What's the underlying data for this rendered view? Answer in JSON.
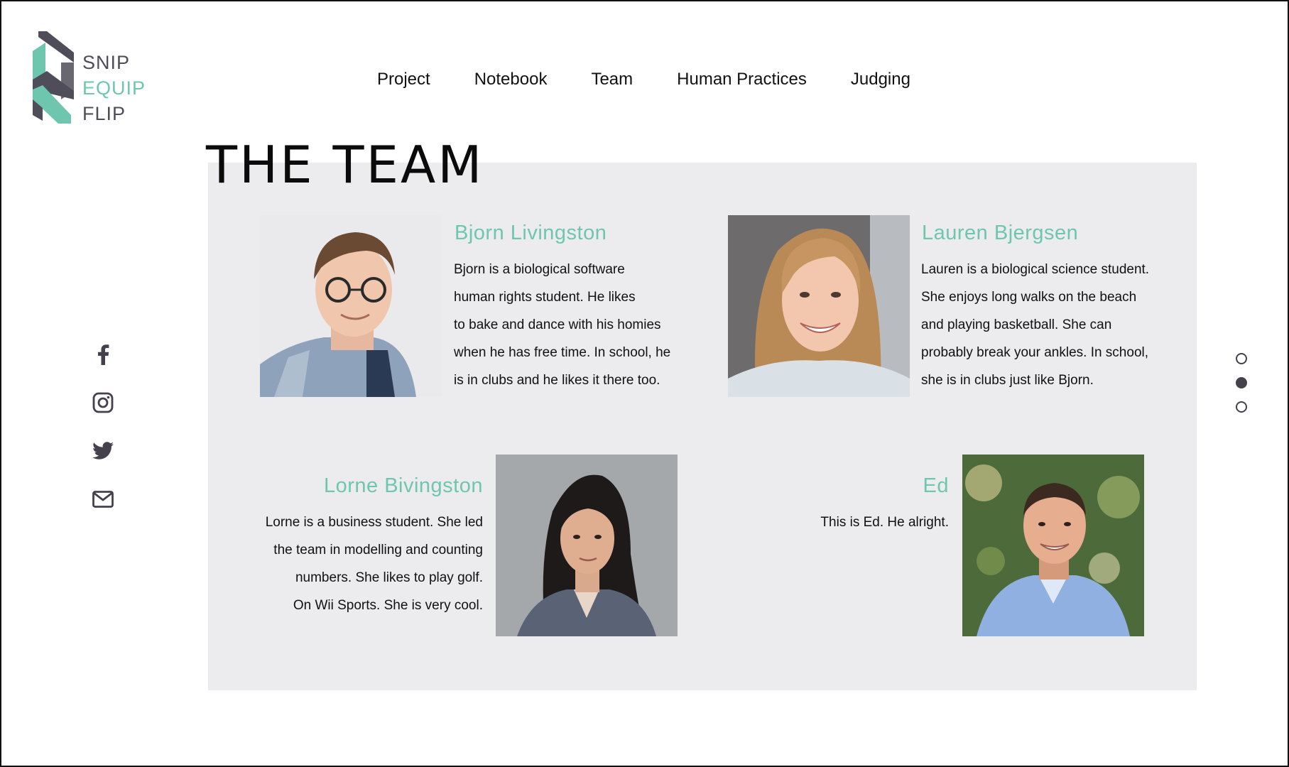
{
  "logo": {
    "line1": "SNIP",
    "line2": "EQUIP",
    "line3": "FLIP",
    "colors": {
      "dark": "#4f4d59",
      "accent": "#6fc6ae"
    }
  },
  "nav": {
    "items": [
      {
        "label": "Project"
      },
      {
        "label": "Notebook"
      },
      {
        "label": "Team"
      },
      {
        "label": "Human Practices"
      },
      {
        "label": "Judging"
      }
    ]
  },
  "page": {
    "title": "THE TEAM"
  },
  "social": {
    "icons": [
      "facebook-icon",
      "instagram-icon",
      "twitter-icon",
      "mail-icon"
    ]
  },
  "pager": {
    "dots": 3,
    "active_index": 1
  },
  "members": [
    {
      "name": "Bjorn Livingston",
      "bio": [
        "Bjorn is a biological software",
        "human rights student. He likes",
        "to bake and dance with his homies",
        "when he has free time. In school, he",
        "is in clubs and he likes it there too."
      ]
    },
    {
      "name": "Lauren Bjergsen",
      "bio": [
        "Lauren is a biological science student.",
        "She enjoys long walks on the beach",
        "and playing basketball. She can",
        "probably break your ankles. In school,",
        "she is in clubs just like Bjorn."
      ]
    },
    {
      "name": "Lorne Bivingston",
      "bio": [
        "Lorne is a business student. She led",
        "the team in modelling and counting",
        "numbers. She likes to play golf.",
        "On Wii Sports. She is very cool."
      ]
    },
    {
      "name": "Ed",
      "bio": [
        "This is Ed. He alright."
      ]
    }
  ],
  "theme": {
    "accent": "#6fc6ae",
    "panel": "#ececee",
    "text": "#111111"
  }
}
